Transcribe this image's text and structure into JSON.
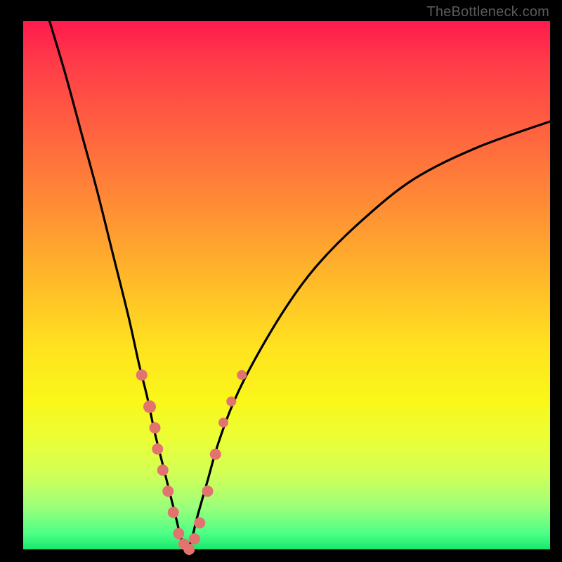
{
  "watermark": "TheBottleneck.com",
  "chart_data": {
    "type": "line",
    "title": "",
    "xlabel": "",
    "ylabel": "",
    "xlim": [
      0,
      100
    ],
    "ylim": [
      0,
      100
    ],
    "series": [
      {
        "name": "bottleneck-curve",
        "x": [
          5,
          8,
          11,
          14,
          17,
          20,
          22,
          23.5,
          25,
          26.5,
          28,
          29,
          30,
          31,
          32,
          33,
          35,
          37,
          40,
          44,
          50,
          56,
          64,
          74,
          86,
          100
        ],
        "y": [
          100,
          90,
          79,
          68,
          56,
          44,
          35,
          29,
          22,
          16,
          10,
          6,
          2,
          0,
          2,
          6,
          13,
          20,
          28,
          36,
          46,
          54,
          62,
          70,
          76,
          81
        ]
      }
    ],
    "markers": {
      "name": "datapoints",
      "color": "#e2736e",
      "points": [
        {
          "x": 22.5,
          "y": 33,
          "r": 8
        },
        {
          "x": 24.0,
          "y": 27,
          "r": 9
        },
        {
          "x": 25.0,
          "y": 23,
          "r": 8
        },
        {
          "x": 25.5,
          "y": 19,
          "r": 8
        },
        {
          "x": 26.5,
          "y": 15,
          "r": 8
        },
        {
          "x": 27.5,
          "y": 11,
          "r": 8
        },
        {
          "x": 28.5,
          "y": 7,
          "r": 8
        },
        {
          "x": 29.5,
          "y": 3,
          "r": 8
        },
        {
          "x": 30.5,
          "y": 1,
          "r": 8
        },
        {
          "x": 31.5,
          "y": 0,
          "r": 8
        },
        {
          "x": 32.5,
          "y": 2,
          "r": 8
        },
        {
          "x": 33.5,
          "y": 5,
          "r": 8
        },
        {
          "x": 35.0,
          "y": 11,
          "r": 8
        },
        {
          "x": 36.5,
          "y": 18,
          "r": 8
        },
        {
          "x": 38.0,
          "y": 24,
          "r": 7
        },
        {
          "x": 39.5,
          "y": 28,
          "r": 7
        },
        {
          "x": 41.5,
          "y": 33,
          "r": 7
        }
      ]
    }
  }
}
